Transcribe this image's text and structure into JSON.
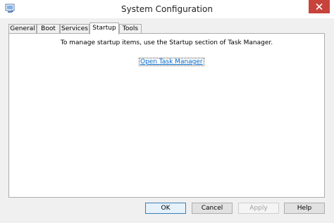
{
  "window": {
    "title": "System Configuration"
  },
  "tabs": [
    {
      "label": "General"
    },
    {
      "label": "Boot"
    },
    {
      "label": "Services"
    },
    {
      "label": "Startup",
      "active": true
    },
    {
      "label": "Tools"
    }
  ],
  "startup": {
    "message": "To manage startup items, use the Startup section of Task Manager.",
    "link_label": "Open Task Manager"
  },
  "buttons": {
    "ok": "OK",
    "cancel": "Cancel",
    "apply": "Apply",
    "help": "Help"
  },
  "colors": {
    "close_button": "#c7433b",
    "link": "#0066cc"
  },
  "icons": {
    "app": "msconfig-icon",
    "close": "close-icon"
  }
}
